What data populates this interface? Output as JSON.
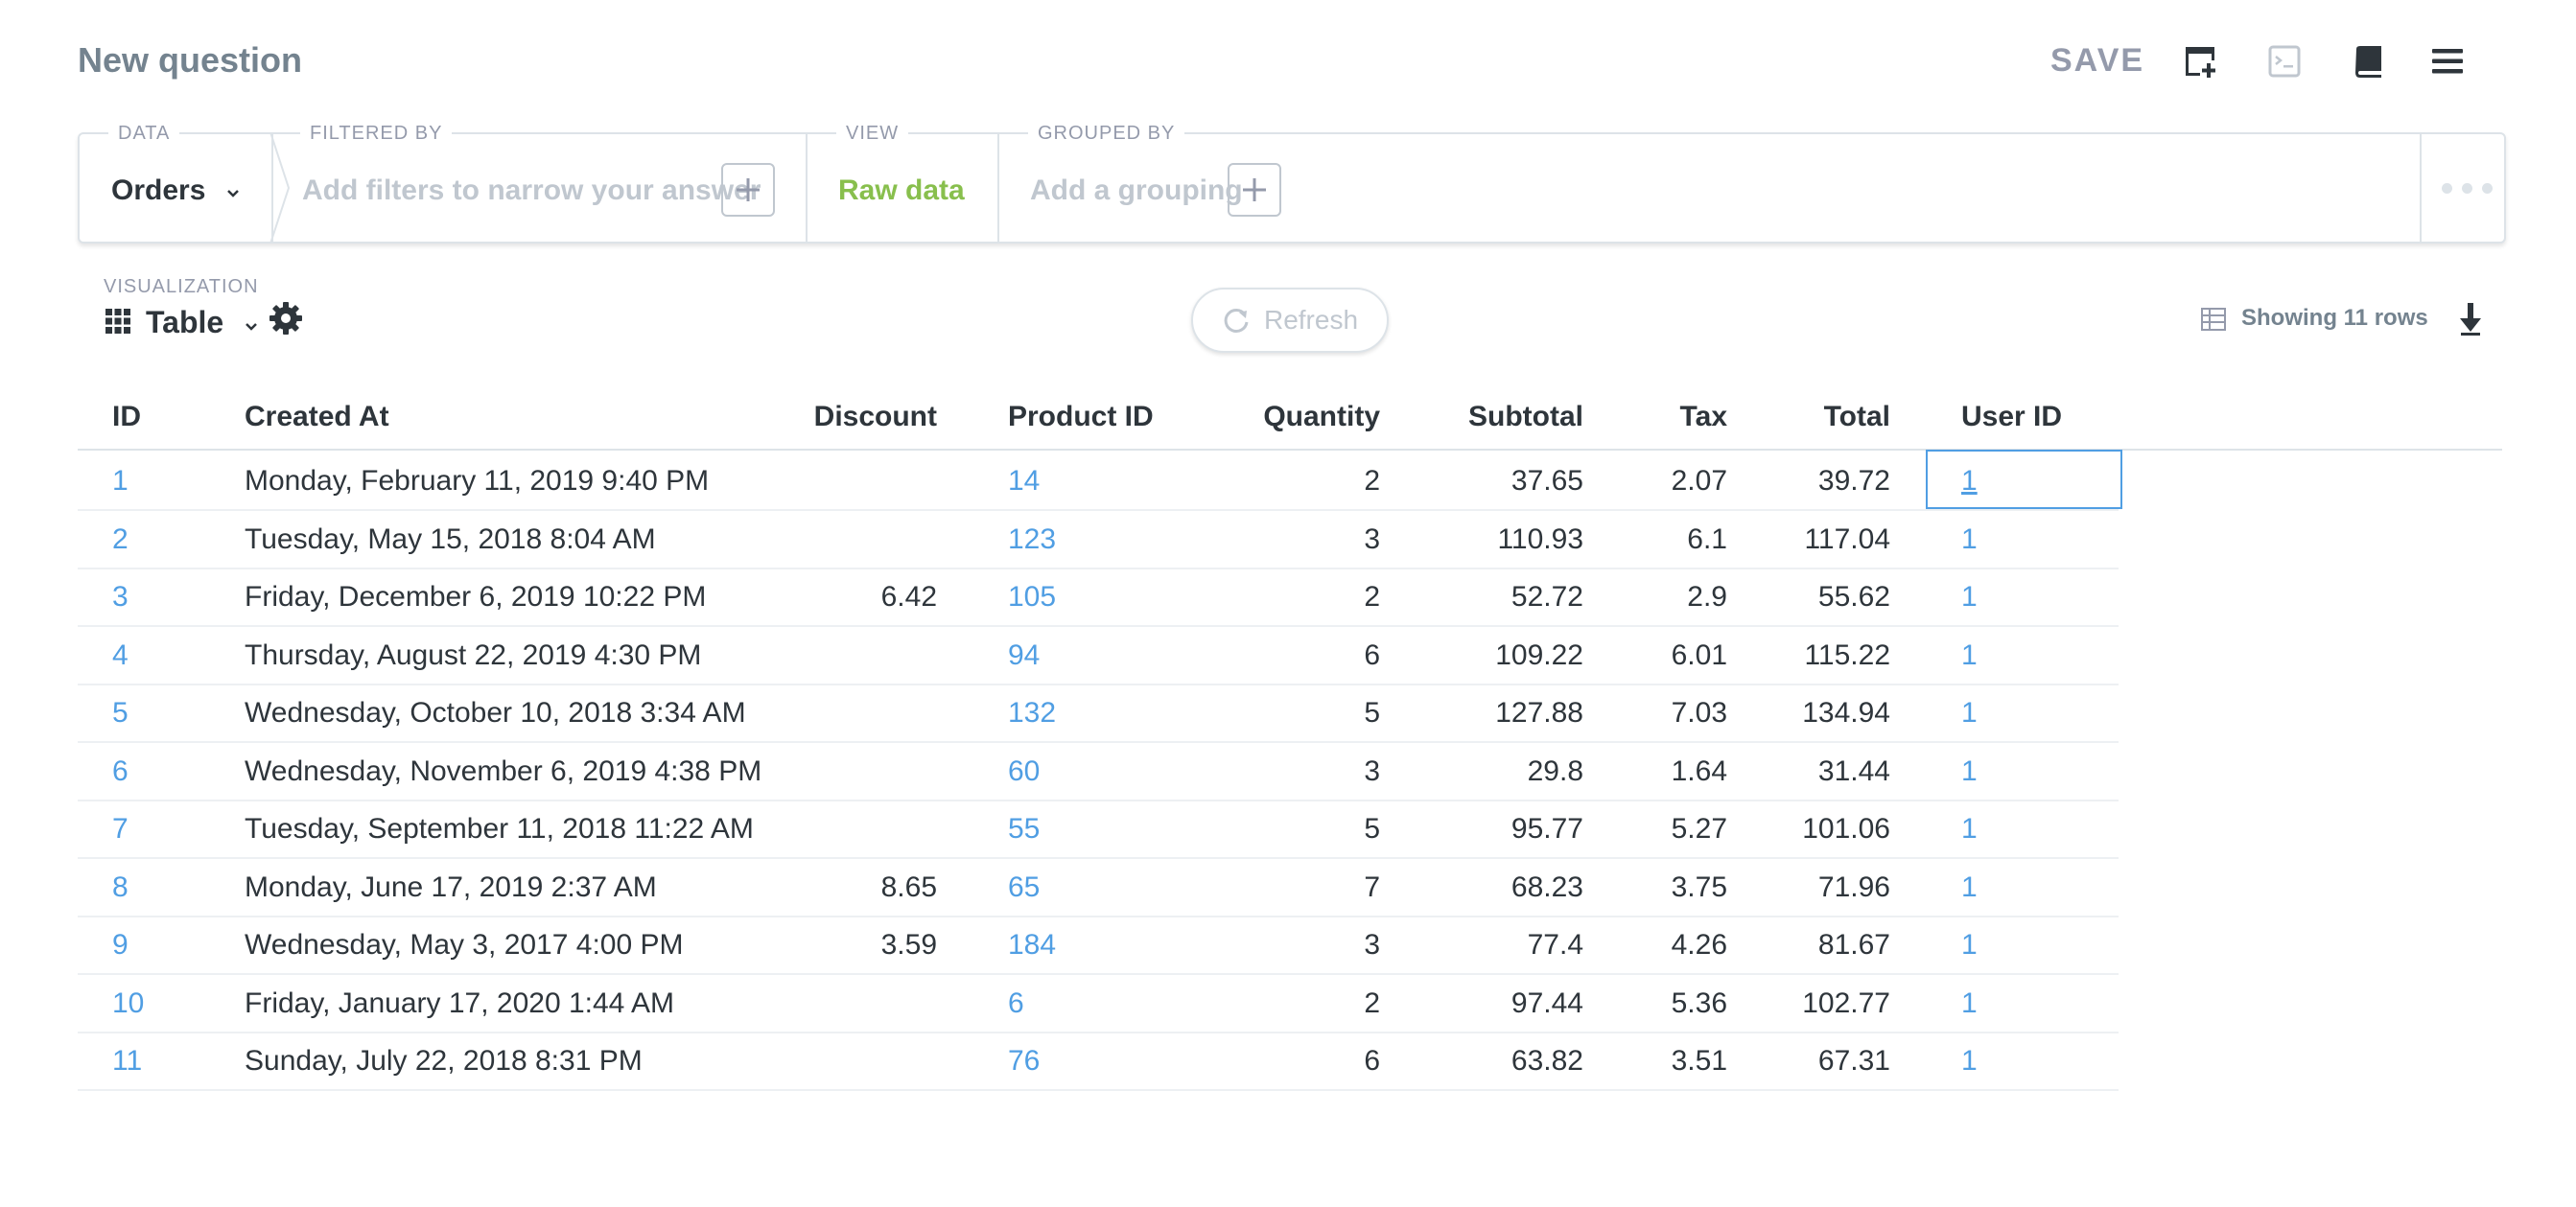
{
  "header": {
    "title": "New question",
    "save_label": "SAVE"
  },
  "query_builder": {
    "data_label": "DATA",
    "data_value": "Orders",
    "filter_label": "FILTERED BY",
    "filter_placeholder": "Add filters to narrow your answer",
    "view_label": "VIEW",
    "view_value": "Raw data",
    "group_label": "GROUPED BY",
    "group_placeholder": "Add a grouping"
  },
  "visualization": {
    "label": "VISUALIZATION",
    "value": "Table"
  },
  "refresh_label": "Refresh",
  "rows_label": "Showing 11 rows",
  "colors": {
    "link": "#509ee3",
    "view_green": "#88bf4d",
    "muted": "#949aab",
    "text": "#2e353b"
  },
  "table": {
    "columns": [
      "ID",
      "Created At",
      "Discount",
      "Product ID",
      "Quantity",
      "Subtotal",
      "Tax",
      "Total",
      "User ID"
    ],
    "rows": [
      [
        "1",
        "Monday, February 11, 2019 9:40 PM",
        "",
        "14",
        "2",
        "37.65",
        "2.07",
        "39.72",
        "1"
      ],
      [
        "2",
        "Tuesday, May 15, 2018 8:04 AM",
        "",
        "123",
        "3",
        "110.93",
        "6.1",
        "117.04",
        "1"
      ],
      [
        "3",
        "Friday, December 6, 2019 10:22 PM",
        "6.42",
        "105",
        "2",
        "52.72",
        "2.9",
        "55.62",
        "1"
      ],
      [
        "4",
        "Thursday, August 22, 2019 4:30 PM",
        "",
        "94",
        "6",
        "109.22",
        "6.01",
        "115.22",
        "1"
      ],
      [
        "5",
        "Wednesday, October 10, 2018 3:34 AM",
        "",
        "132",
        "5",
        "127.88",
        "7.03",
        "134.94",
        "1"
      ],
      [
        "6",
        "Wednesday, November 6, 2019 4:38 PM",
        "",
        "60",
        "3",
        "29.8",
        "1.64",
        "31.44",
        "1"
      ],
      [
        "7",
        "Tuesday, September 11, 2018 11:22 AM",
        "",
        "55",
        "5",
        "95.77",
        "5.27",
        "101.06",
        "1"
      ],
      [
        "8",
        "Monday, June 17, 2019 2:37 AM",
        "8.65",
        "65",
        "7",
        "68.23",
        "3.75",
        "71.96",
        "1"
      ],
      [
        "9",
        "Wednesday, May 3, 2017 4:00 PM",
        "3.59",
        "184",
        "3",
        "77.4",
        "4.26",
        "81.67",
        "1"
      ],
      [
        "10",
        "Friday, January 17, 2020 1:44 AM",
        "",
        "6",
        "2",
        "97.44",
        "5.36",
        "102.77",
        "1"
      ],
      [
        "11",
        "Sunday, July 22, 2018 8:31 PM",
        "",
        "76",
        "6",
        "63.82",
        "3.51",
        "67.31",
        "1"
      ]
    ]
  }
}
